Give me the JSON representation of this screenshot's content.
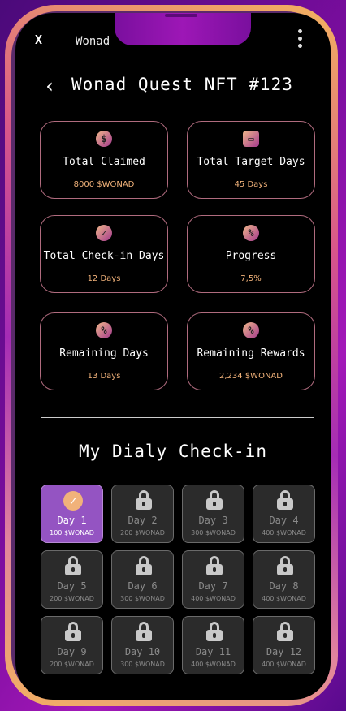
{
  "app": {
    "close_label": "X",
    "title": "Wonad"
  },
  "header": {
    "back_label": "‹",
    "title": "Wonad Quest NFT #123"
  },
  "stats": [
    {
      "label": "Total Claimed",
      "value": "8000 $WONAD",
      "icon": "dollar-icon",
      "glyph": "$"
    },
    {
      "label": "Total Target Days",
      "value": "45 Days",
      "icon": "calendar-icon",
      "glyph": "▭"
    },
    {
      "label": "Total Check-in Days",
      "value": "12 Days",
      "icon": "check-icon",
      "glyph": "✓"
    },
    {
      "label": "Progress",
      "value": "7,5%",
      "icon": "percent-icon",
      "glyph": "%"
    },
    {
      "label": "Remaining Days",
      "value": "13 Days",
      "icon": "percent-icon",
      "glyph": "%"
    },
    {
      "label": "Remaining Rewards",
      "value": "2,234 $WONAD",
      "icon": "percent-icon",
      "glyph": "%"
    }
  ],
  "checkin": {
    "title": "My Dialy Check-in",
    "days": [
      {
        "label": "Day 1",
        "reward": "100 $WONAD",
        "checked": true
      },
      {
        "label": "Day 2",
        "reward": "200 $WONAD",
        "checked": false
      },
      {
        "label": "Day 3",
        "reward": "300 $WONAD",
        "checked": false
      },
      {
        "label": "Day 4",
        "reward": "400 $WONAD",
        "checked": false
      },
      {
        "label": "Day 5",
        "reward": "200 $WONAD",
        "checked": false
      },
      {
        "label": "Day 6",
        "reward": "300 $WONAD",
        "checked": false
      },
      {
        "label": "Day 7",
        "reward": "400 $WONAD",
        "checked": false
      },
      {
        "label": "Day 8",
        "reward": "400 $WONAD",
        "checked": false
      },
      {
        "label": "Day 9",
        "reward": "200 $WONAD",
        "checked": false
      },
      {
        "label": "Day 10",
        "reward": "300 $WONAD",
        "checked": false
      },
      {
        "label": "Day 11",
        "reward": "400 $WONAD",
        "checked": false
      },
      {
        "label": "Day 12",
        "reward": "400 $WONAD",
        "checked": false
      }
    ]
  },
  "colors": {
    "accent": "#f1b27a",
    "active_day": "#9454c2",
    "card_border": "#b06b7e"
  }
}
